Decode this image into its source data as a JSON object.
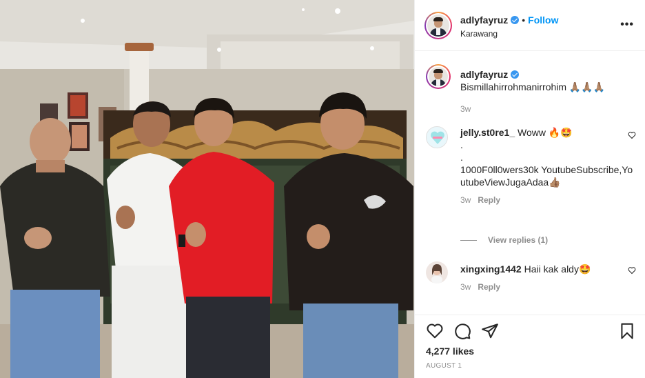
{
  "post": {
    "author": "adlyfayruz",
    "follow_label": "Follow",
    "dot": "•",
    "location": "Karawang",
    "more_label": "•••",
    "caption": "Bismillahirrohmanirrohim 🙏🏽🙏🏽🙏🏽",
    "caption_time": "3w"
  },
  "comments": [
    {
      "username": "jelly.st0re1_",
      "text_lines": [
        "Woww 🔥🤩",
        ".",
        ".",
        "1000F0ll0wers30k YoutubeSubscribe,YoutubeViewJugaAdaa👍🏽"
      ],
      "time": "3w",
      "reply_label": "Reply",
      "view_replies": "View replies (1)"
    },
    {
      "username": "xingxing1442",
      "text_lines": [
        "Haii kak aldy🤩"
      ],
      "time": "3w",
      "reply_label": "Reply"
    }
  ],
  "footer": {
    "likes": "4,277 likes",
    "date": "AUGUST 1"
  },
  "icons": {
    "like": "heart-icon",
    "comment": "comment-icon",
    "share": "share-icon",
    "save": "bookmark-icon",
    "more": "more-icon",
    "verified": "verified-badge-icon"
  },
  "colors": {
    "accent": "#0095f6",
    "verified": "#3897f0",
    "text": "#262626",
    "muted": "#8e8e8e",
    "border": "#efefef"
  }
}
